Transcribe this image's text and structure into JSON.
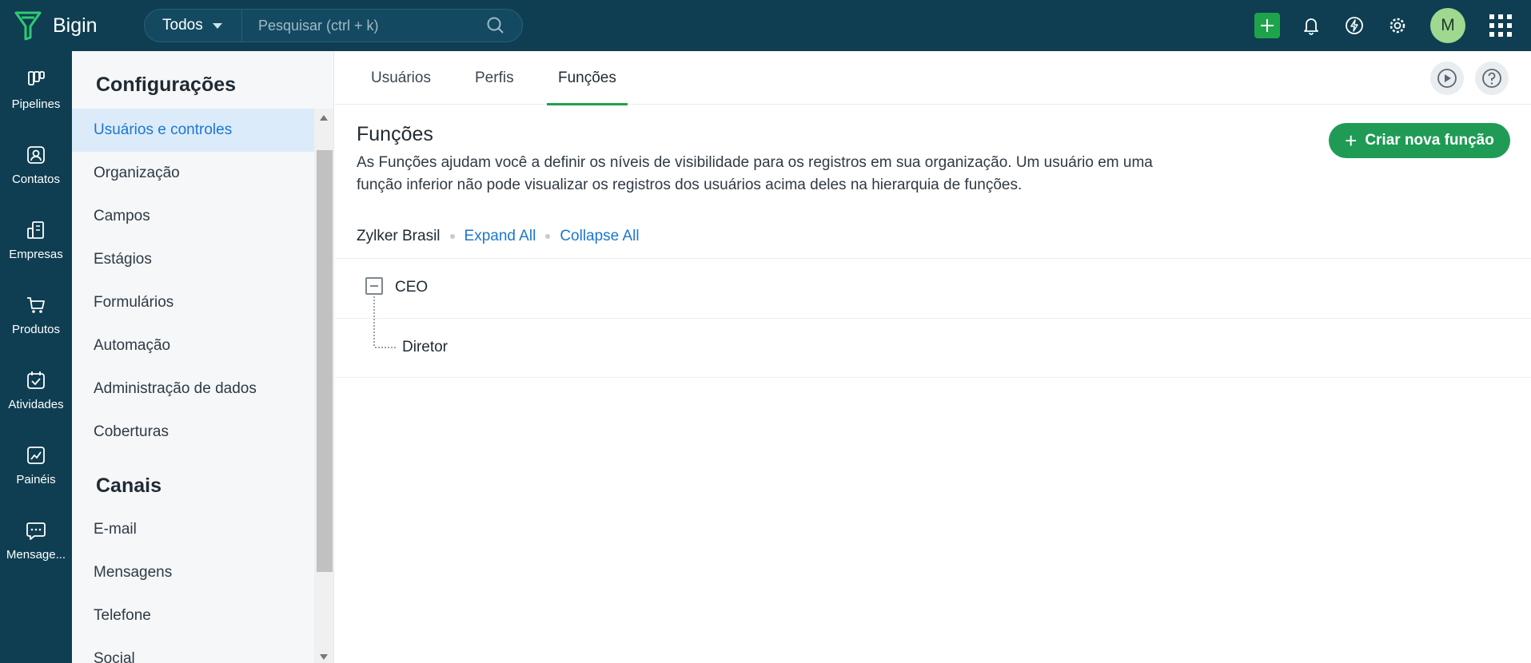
{
  "app": {
    "brand": "Bigin"
  },
  "search": {
    "scope": "Todos",
    "placeholder": "Pesquisar (ctrl + k)"
  },
  "user": {
    "initial": "M"
  },
  "leftnav": [
    {
      "label": "Pipelines",
      "icon": "pipelines-icon"
    },
    {
      "label": "Contatos",
      "icon": "contacts-icon"
    },
    {
      "label": "Empresas",
      "icon": "companies-icon"
    },
    {
      "label": "Produtos",
      "icon": "cart-icon"
    },
    {
      "label": "Atividades",
      "icon": "calendar-check-icon"
    },
    {
      "label": "Painéis",
      "icon": "dashboard-icon"
    },
    {
      "label": "Mensage...",
      "icon": "chat-icon"
    }
  ],
  "settings": {
    "heading": "Configurações",
    "items": [
      "Usuários e controles",
      "Organização",
      "Campos",
      "Estágios",
      "Formulários",
      "Automação",
      "Administração de dados",
      "Coberturas"
    ],
    "channels_heading": "Canais",
    "channels": [
      "E-mail",
      "Mensagens",
      "Telefone",
      "Social"
    ]
  },
  "tabs": [
    "Usuários",
    "Perfis",
    "Funções"
  ],
  "main": {
    "title": "Funções",
    "description": "As Funções ajudam você a definir os níveis de visibilidade para os registros em sua organização. Um usuário em uma função inferior não pode visualizar os registros dos usuários acima deles na hierarquia de funções.",
    "create_button": "Criar nova função",
    "org": "Zylker Brasil",
    "expand_all": "Expand All",
    "collapse_all": "Collapse All",
    "roles": [
      "CEO",
      "Diretor"
    ]
  },
  "colors": {
    "topbar": "#0f3e52",
    "accent_green": "#1f9b55",
    "link_blue": "#1b77d2",
    "active_bg": "#dcebfa"
  }
}
